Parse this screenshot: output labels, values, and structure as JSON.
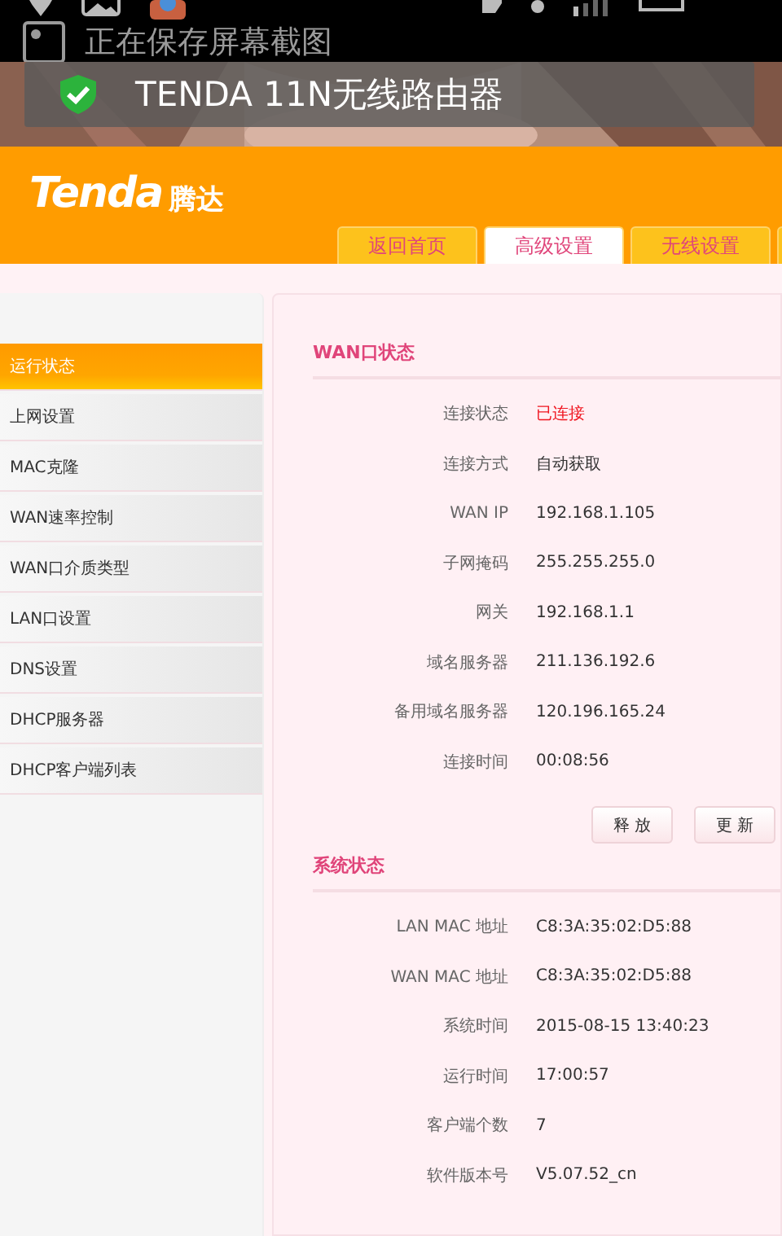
{
  "notification": {
    "text": "正在保存屏幕截图"
  },
  "toast": {
    "title": "TENDA 11N无线路由器"
  },
  "header": {
    "logo": "Tenda",
    "logo_cn": "腾达",
    "tabs": [
      {
        "label": "返回首页",
        "selected": false
      },
      {
        "label": "高级设置",
        "selected": true
      },
      {
        "label": "无线设置",
        "selected": false
      },
      {
        "selected": false
      }
    ]
  },
  "sidebar": {
    "items": [
      {
        "label": "运行状态",
        "selected": true
      },
      {
        "label": "上网设置",
        "selected": false
      },
      {
        "label": "MAC克隆",
        "selected": false
      },
      {
        "label": "WAN速率控制",
        "selected": false
      },
      {
        "label": "WAN口介质类型",
        "selected": false
      },
      {
        "label": "LAN口设置",
        "selected": false
      },
      {
        "label": "DNS设置",
        "selected": false
      },
      {
        "label": "DHCP服务器",
        "selected": false
      },
      {
        "label": "DHCP客户端列表",
        "selected": false
      }
    ]
  },
  "sections": [
    {
      "title": "WAN口状态",
      "rows": [
        {
          "label": "连接状态",
          "value": "已连接",
          "kind": "status"
        },
        {
          "label": "连接方式",
          "value": "自动获取",
          "kind": "plain"
        },
        {
          "label": "WAN IP",
          "value": "192.168.1.105",
          "kind": "plain"
        },
        {
          "label": "子网掩码",
          "value": "255.255.255.0",
          "kind": "plain"
        },
        {
          "label": "网关",
          "value": "192.168.1.1",
          "kind": "plain"
        },
        {
          "label": "域名服务器",
          "value": "211.136.192.6",
          "kind": "plain"
        },
        {
          "label": "备用域名服务器",
          "value": "120.196.165.24",
          "kind": "plain"
        },
        {
          "label": "连接时间",
          "value": "00:08:56",
          "kind": "plain"
        }
      ],
      "buttons": [
        "释 放",
        "更 新"
      ]
    },
    {
      "title": "系统状态",
      "rows": [
        {
          "label": "LAN MAC 地址",
          "value": "C8:3A:35:02:D5:88",
          "kind": "plain"
        },
        {
          "label": "WAN MAC 地址",
          "value": "C8:3A:35:02:D5:88",
          "kind": "plain"
        },
        {
          "label": "系统时间",
          "value": "2015-08-15 13:40:23",
          "kind": "plain"
        },
        {
          "label": "运行时间",
          "value": "17:00:57",
          "kind": "plain"
        },
        {
          "label": "客户端个数",
          "value": "7",
          "kind": "plain"
        },
        {
          "label": "软件版本号",
          "value": "V5.07.52_cn",
          "kind": "plain"
        }
      ]
    }
  ]
}
